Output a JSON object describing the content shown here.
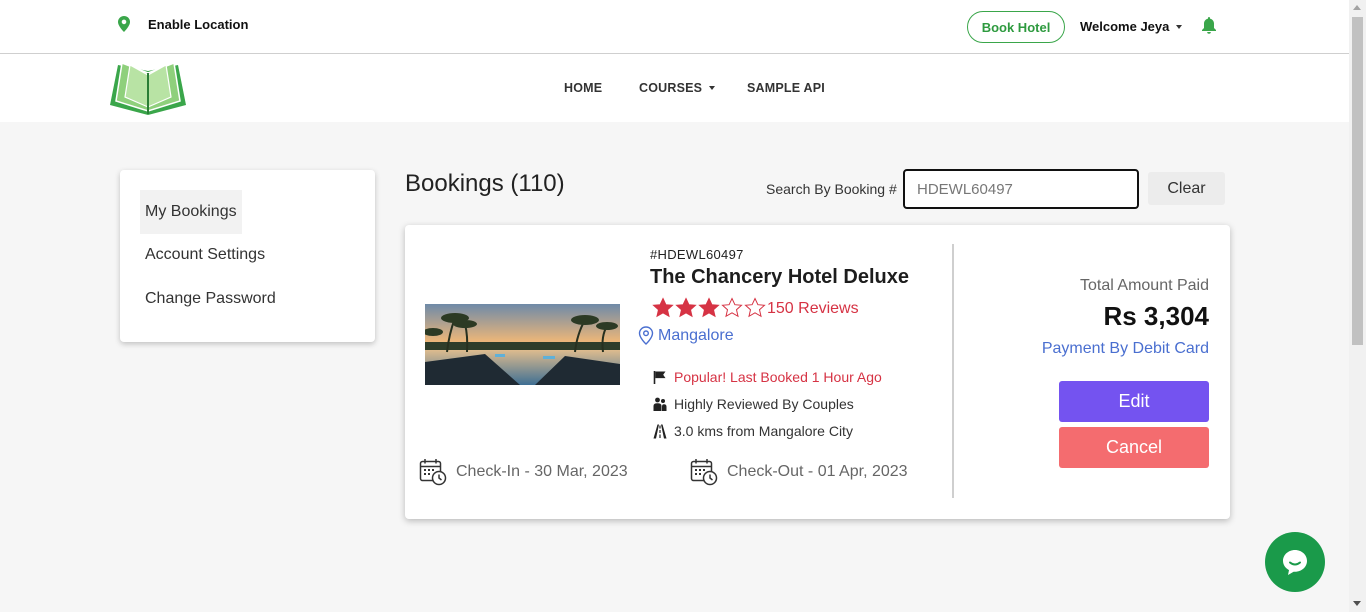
{
  "topbar": {
    "location_label": "Enable Location",
    "book_hotel_label": "Book Hotel",
    "welcome_label": "Welcome Jeya"
  },
  "nav": {
    "items": [
      {
        "label": "HOME",
        "has_dropdown": false
      },
      {
        "label": "COURSES",
        "has_dropdown": true
      },
      {
        "label": "SAMPLE API",
        "has_dropdown": false
      }
    ]
  },
  "sidebar": {
    "items": [
      {
        "label": "My Bookings",
        "active": true
      },
      {
        "label": "Account Settings",
        "active": false
      },
      {
        "label": "Change Password",
        "active": false
      }
    ]
  },
  "main": {
    "title": "Bookings (110)",
    "search": {
      "label": "Search By Booking #",
      "value": "HDEWL60497"
    },
    "clear_label": "Clear"
  },
  "booking": {
    "number": "#HDEWL60497",
    "hotel_name": "The Chancery Hotel Deluxe",
    "rating": 3,
    "max_rating": 5,
    "reviews": "150 Reviews",
    "city": "Mangalore",
    "features": [
      {
        "icon": "flag-icon",
        "text": "Popular! Last Booked 1 Hour Ago"
      },
      {
        "icon": "couple-icon",
        "text": "Highly Reviewed By Couples"
      },
      {
        "icon": "road-icon",
        "text": "3.0 kms from Mangalore City"
      }
    ],
    "check_in": "Check-In - 30 Mar, 2023",
    "check_out": "Check-Out - 01 Apr, 2023",
    "total_label": "Total Amount Paid",
    "total_amount": "Rs 3,304",
    "payment_method": "Payment By Debit Card",
    "edit_label": "Edit",
    "cancel_label": "Cancel"
  },
  "colors": {
    "brand_green": "#3aa64a",
    "accent_red": "#d63344",
    "link_blue": "#4a6fd0",
    "edit_purple": "#7453f0",
    "cancel_salmon": "#f46c6f",
    "chat_green": "#1a9a4a"
  }
}
